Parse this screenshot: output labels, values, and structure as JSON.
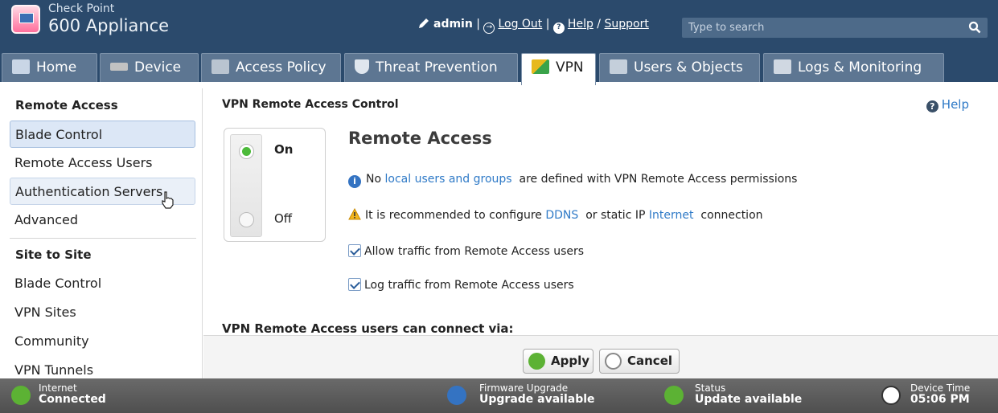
{
  "header": {
    "brand_small": "Check Point",
    "brand_big": "600 Appliance",
    "user": "admin",
    "logout": "Log Out",
    "help": "Help",
    "support": "Support",
    "search_placeholder": "Type to search"
  },
  "tabs": [
    {
      "label": "Home",
      "icon": "home-icon"
    },
    {
      "label": "Device",
      "icon": "device-icon"
    },
    {
      "label": "Access Policy",
      "icon": "access-policy-icon"
    },
    {
      "label": "Threat Prevention",
      "icon": "shield-icon"
    },
    {
      "label": "VPN",
      "icon": "vpn-key-icon"
    },
    {
      "label": "Users & Objects",
      "icon": "users-icon"
    },
    {
      "label": "Logs & Monitoring",
      "icon": "logs-icon"
    }
  ],
  "sidebar": {
    "section1": "Remote Access",
    "items1": [
      "Blade Control",
      "Remote Access Users",
      "Authentication Servers",
      "Advanced"
    ],
    "section2": "Site to Site",
    "items2": [
      "Blade Control",
      "VPN Sites",
      "Community",
      "VPN Tunnels"
    ]
  },
  "main": {
    "title": "VPN Remote Access Control",
    "help": "Help",
    "toggle_on": "On",
    "toggle_off": "Off",
    "ra_title": "Remote Access",
    "msg1_pre": "No",
    "msg1_link": "local users and groups",
    "msg1_post": "are defined with VPN Remote Access permissions",
    "msg2_pre": "It is recommended to configure",
    "msg2_link1": "DDNS",
    "msg2_mid": "or static IP",
    "msg2_link2": "Internet",
    "msg2_post": "connection",
    "chk1": "Allow traffic from Remote Access users",
    "chk2": "Log traffic from Remote Access users",
    "connect_title": "VPN Remote Access users can connect via:",
    "apply": "Apply",
    "cancel": "Cancel"
  },
  "status": {
    "internet_label": "Internet",
    "internet_value": "Connected",
    "fw_label": "Firmware Upgrade",
    "fw_value": "Upgrade available",
    "status_label": "Status",
    "status_value": "Update available",
    "time_label": "Device Time",
    "time_value": "05:06 PM"
  },
  "colors": {
    "header_bg": "#2b4a6c",
    "tab_bg": "#5d7692",
    "link": "#2f7ac7",
    "accent_green": "#5cb234",
    "status_bar": "#5a5a5a"
  }
}
